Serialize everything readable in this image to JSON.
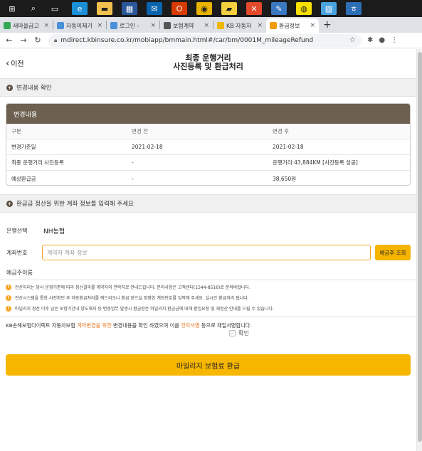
{
  "taskbar": {
    "apps": [
      {
        "icon": "windows-icon",
        "color": "#1b1b1b",
        "glyph": "⊞"
      },
      {
        "icon": "search-icon",
        "color": "#1b1b1b",
        "glyph": "⌕"
      },
      {
        "icon": "task-view-icon",
        "color": "#1b1b1b",
        "glyph": "▭"
      },
      {
        "icon": "edge-icon",
        "color": "#1a8fd8",
        "glyph": "e"
      },
      {
        "icon": "file-explorer-icon",
        "color": "#f2c14e",
        "glyph": "▬"
      },
      {
        "icon": "store-icon",
        "color": "#2b579a",
        "glyph": "▦"
      },
      {
        "icon": "mail-icon",
        "color": "#0a64ad",
        "glyph": "✉"
      },
      {
        "icon": "office-icon",
        "color": "#d83b01",
        "glyph": "O"
      },
      {
        "icon": "chrome-icon",
        "color": "#e8b400",
        "glyph": "◉"
      },
      {
        "icon": "sticky-notes-icon",
        "color": "#f4d03f",
        "glyph": "▰"
      },
      {
        "icon": "x-app-icon",
        "color": "#e24a2b",
        "glyph": "✕"
      },
      {
        "icon": "paint-icon",
        "color": "#3a78c2",
        "glyph": "✎"
      },
      {
        "icon": "kakaotalk-icon",
        "color": "#f9e000",
        "glyph": "◍"
      },
      {
        "icon": "notes-app-icon",
        "color": "#4aa3df",
        "glyph": "▨"
      },
      {
        "icon": "hancom-icon",
        "color": "#2d6fb7",
        "glyph": "ㅎ"
      }
    ]
  },
  "browser": {
    "tabs": [
      {
        "label": "새마을금고",
        "favicon_color": "#34a853",
        "active": false
      },
      {
        "label": "자동이체기",
        "favicon_color": "#4a90d9",
        "active": false
      },
      {
        "label": "로그인 -",
        "favicon_color": "#4a90d9",
        "active": false
      },
      {
        "label": "보험계약",
        "favicon_color": "#555555",
        "active": false
      },
      {
        "label": "KB 자동차",
        "favicon_color": "#f2b705",
        "active": false
      },
      {
        "label": "환급정보",
        "favicon_color": "#f29b05",
        "active": true
      }
    ],
    "url": "mdirect.kbinsure.co.kr/mobiapp/bmmain.html#/car/bm/0001M_mileageRefund"
  },
  "page": {
    "back_label": "이전",
    "title_line1": "최종 운행거리",
    "title_line2": "사진등록 및 환급처리"
  },
  "section1": {
    "label": "변경내용 확인"
  },
  "change_card": {
    "header": "변경내용",
    "columns": [
      "구분",
      "변경 전",
      "변경 후"
    ],
    "rows": [
      [
        "변경기준일",
        "2021-02-18",
        "2021-02-18"
      ],
      [
        "최종 운행거리 사진등록",
        "-",
        "운행거리:43,884KM [사진등록 성공]"
      ],
      [
        "예상환급금",
        "-",
        "38,650원"
      ]
    ]
  },
  "section2": {
    "label": "환급금 정산을 위한 계좌 정보를 입력해 주세요"
  },
  "form": {
    "bank_label": "은행선택",
    "bank_value": "NH농협",
    "account_label": "계좌번호",
    "account_placeholder": "계약자 계좌 정보",
    "inquiry_button": "예금주 조회",
    "holder_label": "예금주이름"
  },
  "notes": [
    "전산처리는 당사 운영기준에 따라 정산결과를 계약자의 연락처로 안내드립니다. 문의사항은 고객센터(1544-8516)로 문의바랍니다.",
    "전산시스템을 통한 사진확인 후 자동환급처리를 해드리오니 환급 받으실 정확한 계좌번호를 입력해 주세요. 실시간 환급처리 됩니다.",
    "마일리지 정산 이후 남은 보험기간내 양도해지 등 변경업무 발생시 환급받은 마일리지 환급금에 대해 환입요청 및 재정산 안내를 드릴 수 있습니다."
  ],
  "agreement": {
    "part1": "KB손해보험다이렉트 자동차보험 ",
    "part2": "계약변경을 위한",
    "part3": " 변경내용을 확인 하였으며 이를 ",
    "part4": "전자서명",
    "part5": " 등으로 재일서명합니다.",
    "confirm_label": "확인"
  },
  "submit_button": "마일리지 보험료 환급",
  "colors": {
    "card_header": "#6d6050",
    "accent_yellow": "#f7b600",
    "highlight_orange": "#e87722"
  }
}
